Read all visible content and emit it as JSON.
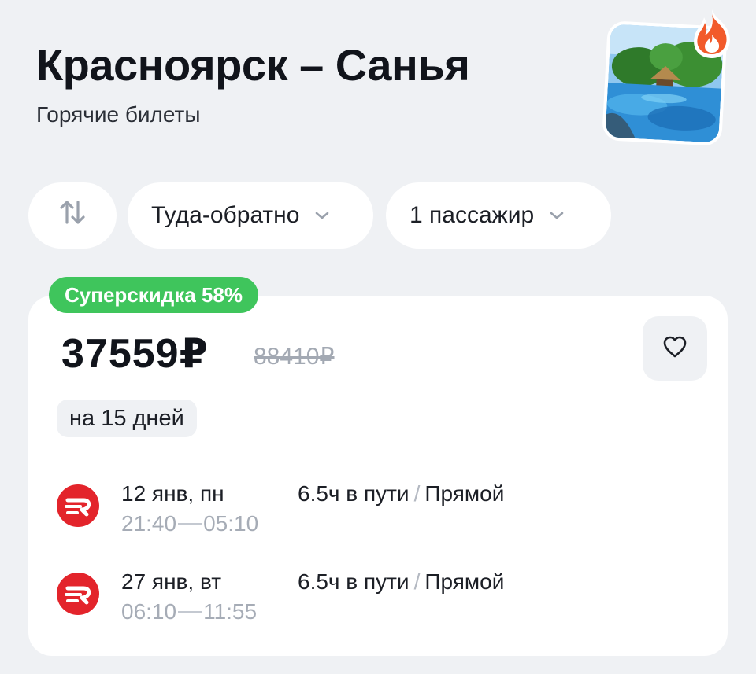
{
  "header": {
    "title": "Красноярск – Санья",
    "subtitle": "Горячие билеты"
  },
  "hero": {
    "image_icon": "tropical-pool-photo",
    "fire_icon": "fire-icon",
    "fire_color": "#f25a2a"
  },
  "filters": {
    "swap_icon": "swap-arrows-icon",
    "trip_type": "Туда-обратно",
    "passengers": "1 пассажир"
  },
  "offer": {
    "badge": "Суперскидка 58%",
    "badge_color": "#3fc55c",
    "price": "37559₽",
    "old_price": "88410₽",
    "duration_chip": "на 15 дней",
    "favorite_icon": "heart-icon",
    "segments": [
      {
        "airline_icon": "airline-logo-icon",
        "airline_color": "#e3242b",
        "date": "12 янв, пн",
        "depart": "21:40",
        "arrive": "05:10",
        "duration": "6.5ч в пути",
        "separator": "/",
        "type": "Прямой"
      },
      {
        "airline_icon": "airline-logo-icon",
        "airline_color": "#e3242b",
        "date": "27 янв, вт",
        "depart": "06:10",
        "arrive": "11:55",
        "duration": "6.5ч в пути",
        "separator": "/",
        "type": "Прямой"
      }
    ]
  }
}
